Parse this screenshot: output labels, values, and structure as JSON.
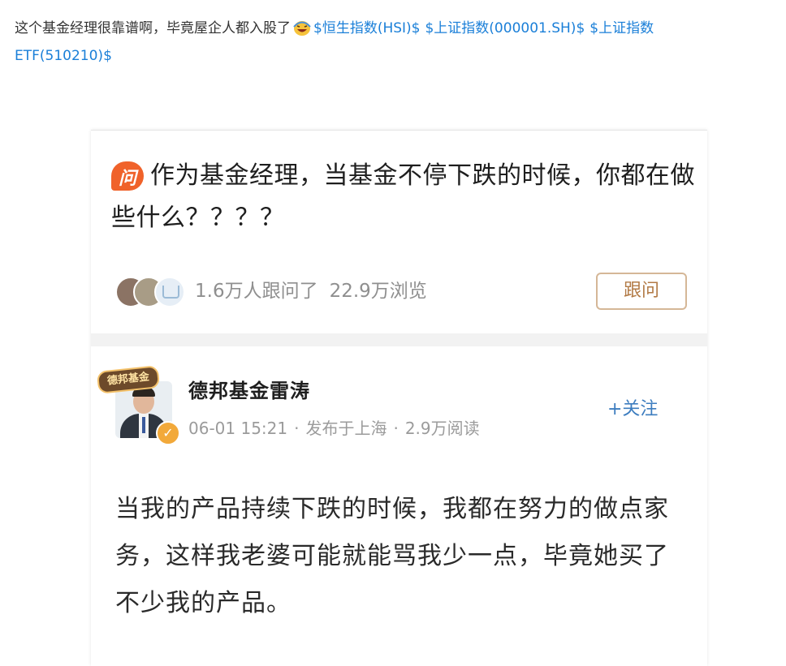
{
  "post": {
    "text": "这个基金经理很靠谱啊，毕竟屋企人都入股了",
    "emoji_icon": "laughing-emoji",
    "stocks": [
      "$恒生指数(HSI)$",
      "$上证指数(000001.SH)$",
      "$上证指数ETF(510210)$"
    ]
  },
  "question": {
    "badge": "问",
    "title": "作为基金经理，当基金不停下跌的时候，你都在做些什么？？？？",
    "followers": "1.6万人跟问了",
    "views": "22.9万浏览",
    "follow_label": "跟问"
  },
  "answer": {
    "org_badge": "德邦基金",
    "author": "德邦基金雷涛",
    "date": "06-01 15:21",
    "location": "发布于上海",
    "reads": "2.9万阅读",
    "follow_label": "+关注",
    "body": "当我的产品持续下跌的时候，我都在努力的做点家务，这样我老婆可能就能骂我少一点，毕竟她买了不少我的产品。"
  },
  "colors": {
    "link": "#1a7fd8",
    "badge": "#f0622a",
    "follow_border": "#d5b797",
    "follow_text": "#b27a45",
    "verified": "#f2a93a",
    "follow_link": "#3d7dbf"
  }
}
